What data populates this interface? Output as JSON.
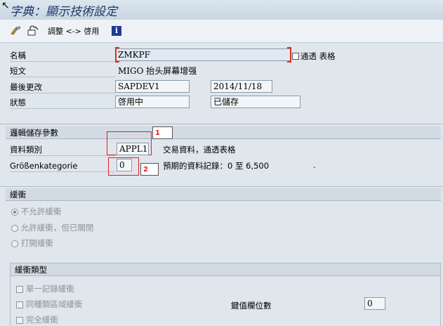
{
  "title": "字典：顯示技術設定",
  "toolbar": {
    "toggle_label": "調整 <-> 啓用",
    "info_label": "i"
  },
  "header": {
    "name": {
      "label": "名稱",
      "value": "ZMKPF",
      "checkbox_label": "通透 表格"
    },
    "short_text": {
      "label": "短文",
      "value": "MIGO 抬头屏幕增强"
    },
    "last_changed": {
      "label": "最後更改",
      "user": "SAPDEV1",
      "date": "2014/11/18"
    },
    "status": {
      "label": "狀態",
      "value1": "啓用中",
      "value2": "已儲存"
    }
  },
  "logical_storage": {
    "title": "邏輯儲存參數",
    "data_class": {
      "label": "資料類別",
      "value": "APPL1",
      "desc": "交易資料，通透表格",
      "marker": "1"
    },
    "size_category": {
      "label": "Größenkategorie",
      "value": "0",
      "desc": "預期的資料記錄：0 至 6,500",
      "dot": ".",
      "marker": "2"
    }
  },
  "buffering": {
    "title": "緩衝",
    "options": [
      {
        "label": "不允許緩衝",
        "selected": true
      },
      {
        "label": "允許緩衝，但已關閉",
        "selected": false
      },
      {
        "label": "打開緩衝",
        "selected": false
      }
    ]
  },
  "buffer_type": {
    "title": "緩衝類型",
    "options": [
      {
        "label": "單一記錄緩衝"
      },
      {
        "label": "同種類區域緩衝"
      },
      {
        "label": "完全緩衝"
      }
    ],
    "key_fields_label": "鍵值欄位數",
    "key_fields_value": "0"
  }
}
